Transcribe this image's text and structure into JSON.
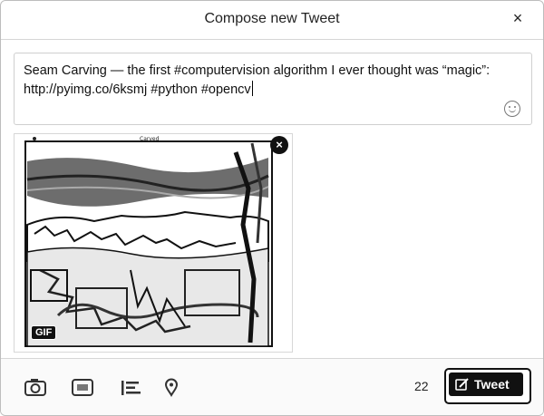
{
  "dialog": {
    "title": "Compose new Tweet",
    "close_glyph": "×"
  },
  "composer": {
    "text": "Seam Carving — the first #computervision algorithm I ever thought was “magic”: http://pyimg.co/6ksmj #python #opencv",
    "emoji_icon": "smiley-icon"
  },
  "media": {
    "badge": "GIF",
    "remove_glyph": "×",
    "caption": "Carved"
  },
  "toolbar": {
    "icons": [
      "camera-icon",
      "gif-icon",
      "poll-icon",
      "location-pin-icon"
    ],
    "char_count": "22",
    "tweet_label": "Tweet"
  }
}
